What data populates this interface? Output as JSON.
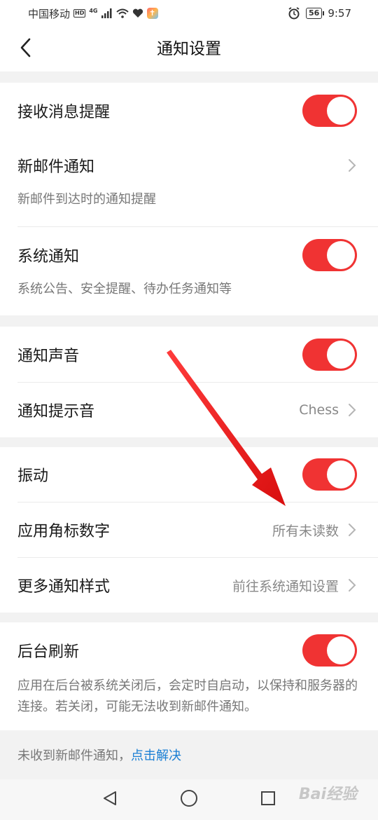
{
  "status_bar": {
    "carrier": "中国移动",
    "hd_badge": "HD",
    "network": "4G",
    "battery": "56",
    "time": "9:57"
  },
  "header": {
    "title": "通知设置"
  },
  "group1": {
    "receive_alerts": {
      "label": "接收消息提醒",
      "enabled": true
    },
    "new_mail": {
      "label": "新邮件通知",
      "desc": "新邮件到达时的通知提醒"
    },
    "system_notice": {
      "label": "系统通知",
      "enabled": true,
      "desc": "系统公告、安全提醒、待办任务通知等"
    }
  },
  "group2": {
    "notify_sound": {
      "label": "通知声音",
      "enabled": true
    },
    "notify_tone": {
      "label": "通知提示音",
      "value": "Chess"
    }
  },
  "group3": {
    "vibrate": {
      "label": "振动",
      "enabled": true
    },
    "badge_number": {
      "label": "应用角标数字",
      "value": "所有未读数"
    },
    "more_styles": {
      "label": "更多通知样式",
      "value": "前往系统通知设置"
    }
  },
  "group4": {
    "background_refresh": {
      "label": "后台刷新",
      "enabled": true,
      "desc": "应用在后台被系统关闭后，会定时自启动，以保持和服务器的连接。若关闭，可能无法收到新邮件通知。"
    }
  },
  "help": {
    "text": "未收到新邮件通知，",
    "link": "点击解决"
  },
  "watermark": "Bai经验",
  "colors": {
    "toggle_on": "#f03333",
    "link": "#1a7fd4",
    "arrow": "#e81c1c"
  },
  "icons": {
    "back": "chevron-left-icon",
    "chevron": "chevron-right-icon",
    "nav_back": "triangle-back-icon",
    "nav_home": "circle-home-icon",
    "nav_recent": "square-recent-icon"
  }
}
